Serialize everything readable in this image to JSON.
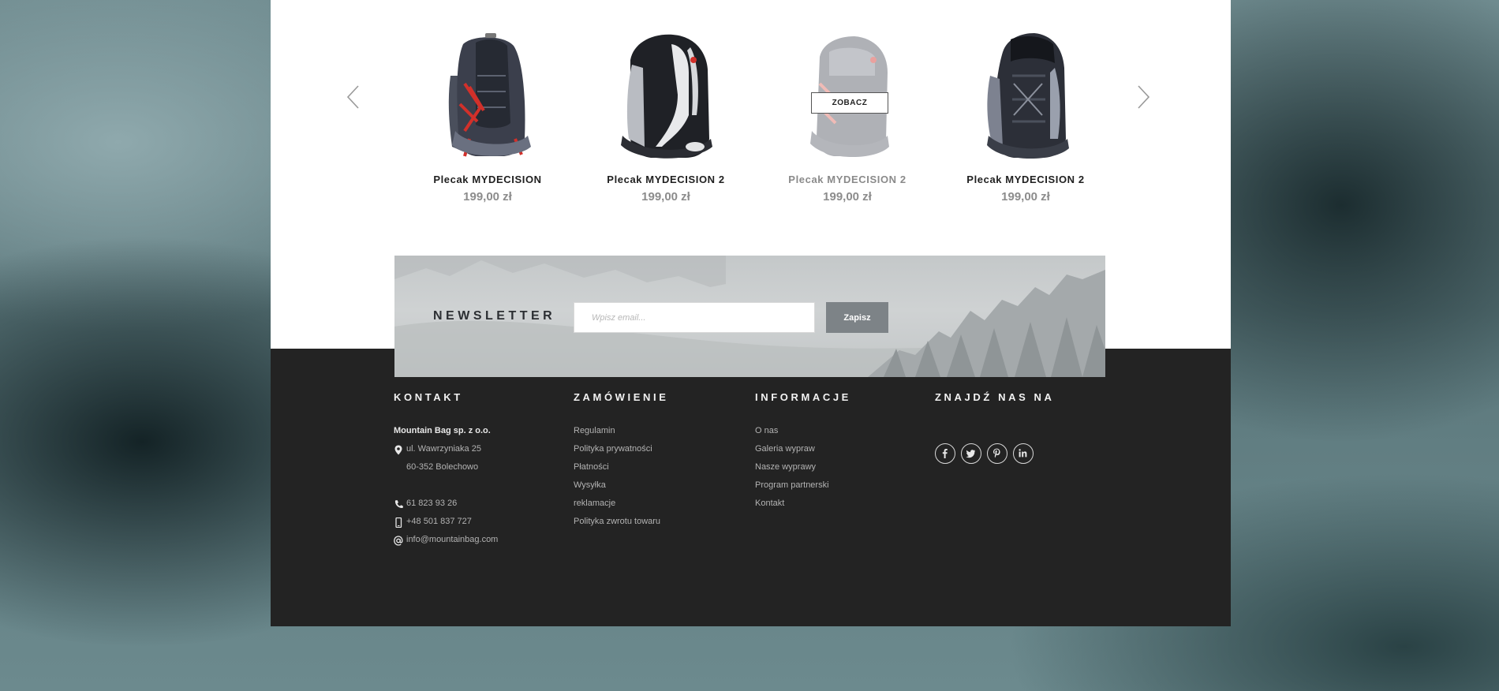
{
  "carousel": {
    "prev_icon": "chevron-left-icon",
    "next_icon": "chevron-right-icon",
    "products": [
      {
        "name": "Plecak MYDECISION",
        "price": "199,00 zł",
        "state": "normal"
      },
      {
        "name": "Plecak MYDECISION 2",
        "price": "199,00 zł",
        "state": "normal"
      },
      {
        "name": "Plecak MYDECISION 2",
        "price": "199,00 zł",
        "state": "hover"
      },
      {
        "name": "Plecak MYDECISION 2",
        "price": "199,00 zł",
        "state": "normal"
      }
    ],
    "hover_button_label": "ZOBACZ"
  },
  "newsletter": {
    "title": "NEWSLETTER",
    "input_placeholder": "Wpisz email...",
    "input_value": "",
    "button_label": "Zapisz"
  },
  "footer": {
    "kontakt": {
      "heading": "KONTAKT",
      "company": "Mountain Bag sp. z o.o.",
      "address_line1": "ul. Wawrzyniaka 25",
      "address_line2": "60-352 Bolechowo",
      "phone": "61 823 93 26",
      "mobile": "+48 501 837 727",
      "email": "info@mountainbag.com"
    },
    "zamowienie": {
      "heading": "ZAMÓWIENIE",
      "links": [
        "Regulamin",
        "Polityka prywatności",
        "Płatności",
        "Wysyłka",
        "reklamacje",
        "Polityka zwrotu towaru"
      ]
    },
    "informacje": {
      "heading": "INFORMACJE",
      "links": [
        "O nas",
        "Galeria wypraw",
        "Nasze wyprawy",
        "Program partnerski",
        "Kontakt"
      ]
    },
    "social": {
      "heading": "ZNAJDŹ NAS NA",
      "icons": [
        "facebook-icon",
        "twitter-icon",
        "pinterest-icon",
        "linkedin-icon"
      ]
    }
  },
  "colors": {
    "footer_bg": "#232323",
    "page_bg": "#ffffff",
    "button_bg": "#7d8387",
    "price": "#8c8c8c"
  }
}
